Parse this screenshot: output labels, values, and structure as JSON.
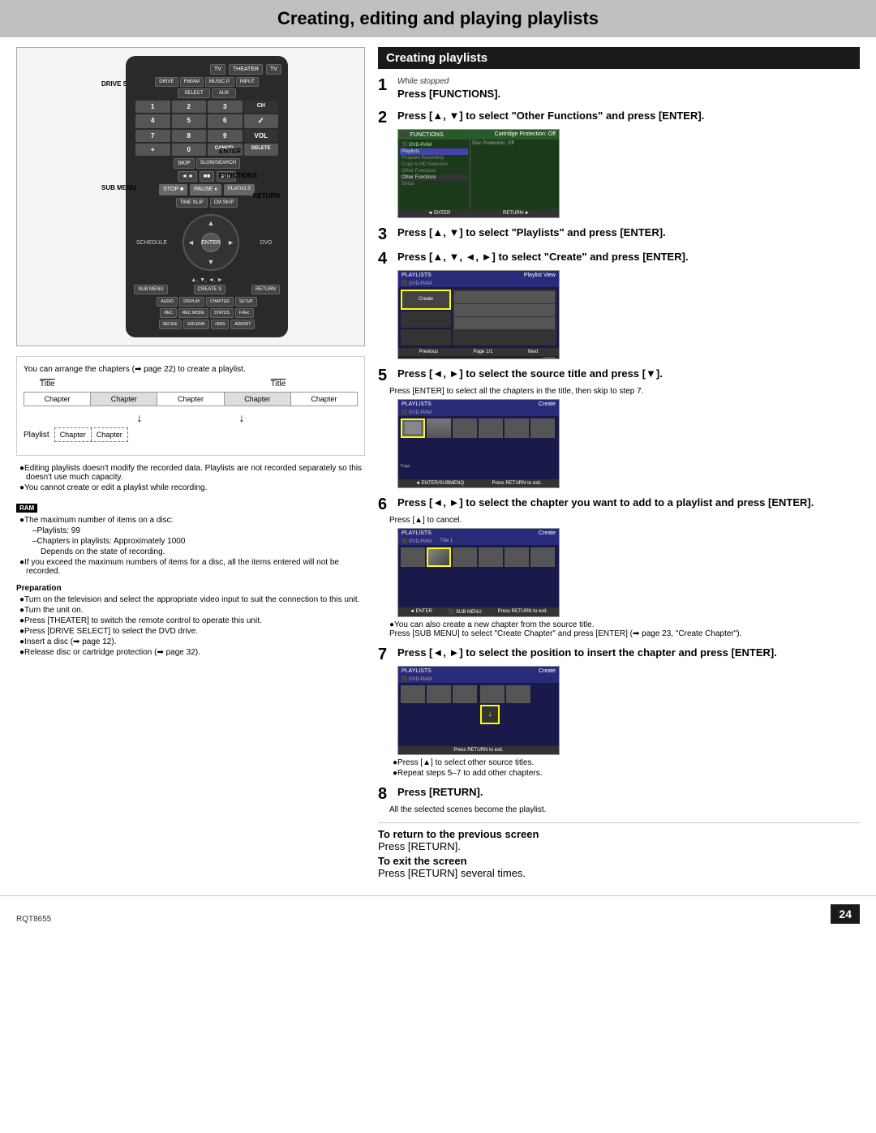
{
  "page": {
    "title": "Creating, editing and playing playlists",
    "page_number": "24",
    "model_code": "RQT8655"
  },
  "header": {
    "title": "Creating, editing and playing playlists"
  },
  "left_section": {
    "remote": {
      "labels": {
        "drive_select": "DRIVE SELECT",
        "theater": "THEATER",
        "sub_menu": "SUB MENU",
        "enter": "ENTER",
        "functions": "FUNCTIONS",
        "return": "RETURN",
        "arrow_label": "▲, ▼, ◄, ►"
      },
      "buttons": [
        "TV",
        "THEATER",
        "TV",
        "DRIVE",
        "FM/AM",
        "MUSIC P.",
        "INPUT",
        "SELECT",
        "AUX",
        "1",
        "2",
        "3",
        "CH",
        "4",
        "5",
        "6",
        "7",
        "8",
        "9",
        "+",
        "0",
        "VOLUME",
        "CANCEL",
        "DELETE",
        "SKIP",
        "SLOW/SEARCH",
        "STOP",
        "PAUSE",
        "PLAY/x1.3",
        "TIME SLIP",
        "CM SKIP",
        "SCHEDULE",
        "SUB MENU",
        "CREATE",
        "RETURN",
        "AUDIO",
        "DISPLAY",
        "CHAPTER",
        "SETUP",
        "REC",
        "REC MODE",
        "STATUS",
        "F.Rec",
        "SEC/EE",
        "S3D.ENH",
        "×BSS",
        "ADD/DIT"
      ]
    },
    "diagram": {
      "note": "You can arrange the chapters (➡ page 22) to create a playlist.",
      "title_label": "Title",
      "title_label2": "Title",
      "chapters": [
        "Chapter",
        "Chapter",
        "Chapter",
        "Chapter",
        "Chapter"
      ],
      "playlist_label": "Playlist",
      "playlist_chapters": [
        "Chapter",
        "Chapter"
      ]
    },
    "editing_note1": "●Editing playlists doesn't modify the recorded data. Playlists are not recorded separately so this doesn't use much capacity.",
    "editing_note2": "●You cannot create or edit a playlist while recording.",
    "ram_label": "RAM",
    "ram_notes": [
      "●The maximum number of items on a disc:",
      "–Playlists:    99",
      "–Chapters in playlists:  Approximately 1000",
      "Depends on the state of recording.",
      "●If you exceed the maximum numbers of items for a disc, all the items entered will not be recorded."
    ],
    "preparation": {
      "title": "Preparation",
      "items": [
        "●Turn on the television and select the appropriate video input to suit the connection to this unit.",
        "●Turn the unit on.",
        "●Press [THEATER] to switch the remote control to operate this unit.",
        "●Press [DRIVE SELECT] to select the DVD drive.",
        "●Insert a disc (➡ page 12).",
        "●Release disc or cartridge protection (➡ page 32)."
      ]
    }
  },
  "right_section": {
    "section_title": "Creating playlists",
    "steps": [
      {
        "num": "1",
        "sub": "While stopped",
        "text": "Press [FUNCTIONS]."
      },
      {
        "num": "2",
        "text": "Press [▲, ▼] to select \"Other Functions\" and press [ENTER]."
      },
      {
        "num": "3",
        "text": "Press [▲, ▼] to select \"Playlists\" and press [ENTER]."
      },
      {
        "num": "4",
        "text": "Press [▲, ▼, ◄, ►] to select \"Create\" and press [ENTER]."
      },
      {
        "num": "5",
        "text": "Press [◄, ►] to select the source title and press [▼].",
        "note": "Press [ENTER] to select all the chapters in the title, then skip to step 7."
      },
      {
        "num": "6",
        "text": "Press [◄, ►] to select the chapter you want to add to a playlist and press [ENTER].",
        "note": "Press [▲] to cancel.",
        "extra_note": "●You can also create a new chapter from the source title. Press [SUB MENU] to select \"Create Chapter\" and press [ENTER] (➡ page 23, \"Create Chapter\")."
      },
      {
        "num": "7",
        "text": "Press [◄, ►] to select the position to insert the chapter and press [ENTER].",
        "notes": [
          "●Press [▲] to select other source titles.",
          "●Repeat steps 5–7 to add other chapters."
        ]
      },
      {
        "num": "8",
        "text": "Press [RETURN].",
        "note": "All the selected scenes become the playlist."
      }
    ],
    "footer_notes": {
      "return_note_title": "To return to the previous screen",
      "return_note": "Press [RETURN].",
      "exit_note_title": "To exit the screen",
      "exit_note": "Press [RETURN] several times."
    }
  }
}
